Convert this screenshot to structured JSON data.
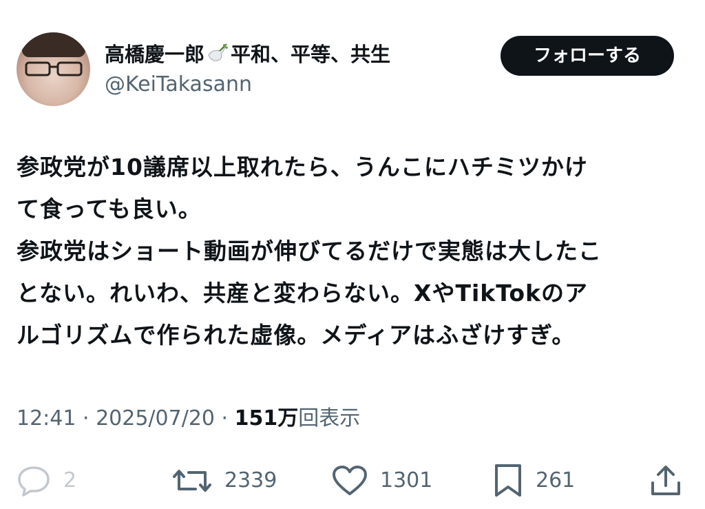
{
  "user": {
    "display_name_part1": "高橋慶一郎",
    "display_name_part2": "平和、平等、共生",
    "handle": "@KeiTakasann",
    "name_icon": "dove-icon"
  },
  "follow_button": {
    "label": "フォローする"
  },
  "tweet": {
    "text": "参政党が10議席以上取れたら、うんこにハチミツかけ\nて食っても良い。\n参政党はショート動画が伸びてるだけで実態は大したこ\nとない。れいわ、共産と変わらない。XやTikTokのア\nルゴリズムで作られた虚像。メディアはふざけすぎ。"
  },
  "meta": {
    "time": "12:41",
    "separator": " · ",
    "date": "2025/07/20",
    "views_count": "151万",
    "views_label": "回表示"
  },
  "actions": {
    "reply_count": "2",
    "retweet_count": "2339",
    "like_count": "1301",
    "bookmark_count": "261"
  },
  "icons": {
    "reply": "reply-icon",
    "retweet": "retweet-icon",
    "like": "heart-icon",
    "bookmark": "bookmark-icon",
    "share": "share-icon"
  },
  "colors": {
    "text": "#0f1419",
    "secondary": "#536471",
    "button_bg": "#0f1419",
    "button_text": "#ffffff"
  }
}
